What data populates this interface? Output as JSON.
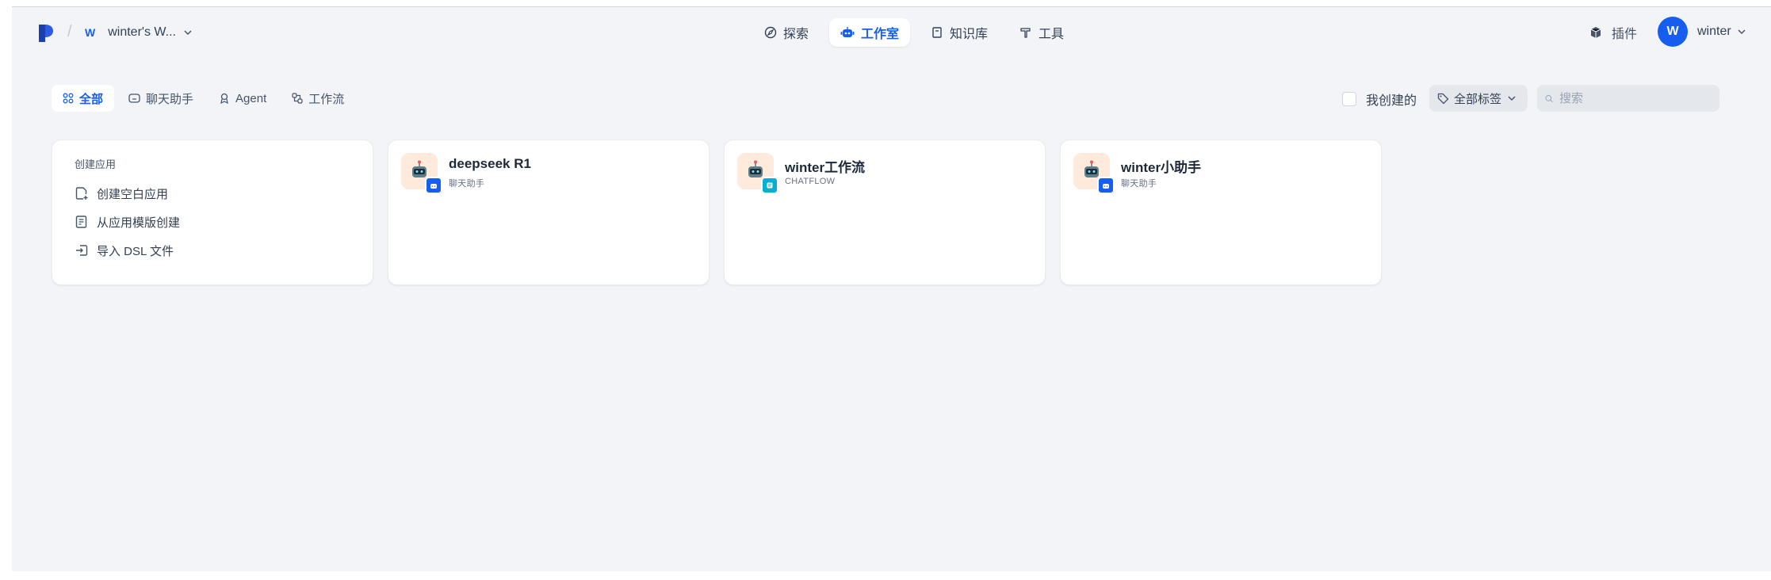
{
  "workspace": {
    "badge": "W",
    "name": "winter's W..."
  },
  "nav": {
    "explore": "探索",
    "studio": "工作室",
    "knowledge": "知识库",
    "tools": "工具"
  },
  "plugins_label": "插件",
  "user": {
    "initial": "W",
    "name": "winter"
  },
  "tabs": {
    "all": "全部",
    "chat": "聊天助手",
    "agent": "Agent",
    "workflow": "工作流"
  },
  "filter": {
    "mine": "我创建的",
    "tags": "全部标签",
    "search_placeholder": "搜索"
  },
  "create": {
    "title": "创建应用",
    "blank": "创建空白应用",
    "template": "从应用模版创建",
    "import": "导入 DSL 文件"
  },
  "apps": [
    {
      "name": "deepseek R1",
      "type": "聊天助手",
      "badge_color": "#155eef"
    },
    {
      "name": "winter工作流",
      "type": "CHATFLOW",
      "badge_color": "#06aed4"
    },
    {
      "name": "winter小助手",
      "type": "聊天助手",
      "badge_color": "#155eef"
    }
  ],
  "colors": {
    "accent": "#155eef",
    "background": "#f2f4f7",
    "icon_bg": "#ffeadb"
  }
}
